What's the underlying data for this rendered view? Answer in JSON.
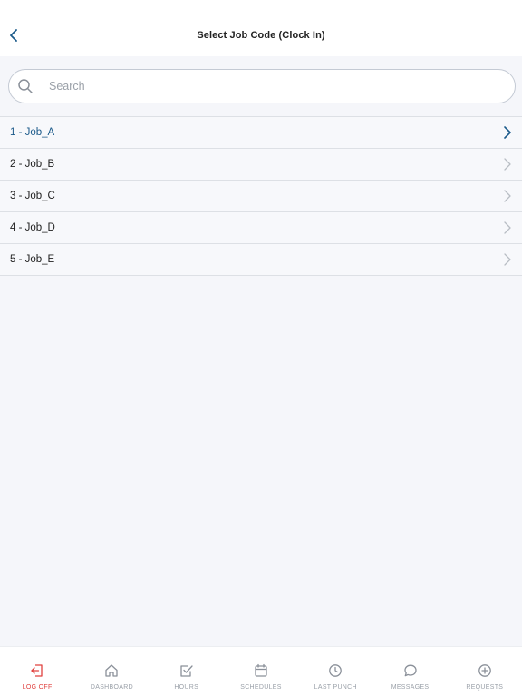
{
  "header": {
    "title": "Select Job Code (Clock In)"
  },
  "search": {
    "placeholder": "Search"
  },
  "jobs": [
    {
      "label": "1 - Job_A"
    },
    {
      "label": "2 - Job_B"
    },
    {
      "label": "3 - Job_C"
    },
    {
      "label": "4 - Job_D"
    },
    {
      "label": "5 - Job_E"
    }
  ],
  "tabs": [
    {
      "label": "LOG OFF",
      "icon": "log-off-icon"
    },
    {
      "label": "DASHBOARD",
      "icon": "home-icon"
    },
    {
      "label": "HOURS",
      "icon": "checkbox-icon"
    },
    {
      "label": "SCHEDULES",
      "icon": "calendar-icon"
    },
    {
      "label": "LAST PUNCH",
      "icon": "clock-icon"
    },
    {
      "label": "MESSAGES",
      "icon": "chat-bubble-icon"
    },
    {
      "label": "REQUESTS",
      "icon": "plus-circle-icon"
    }
  ],
  "colors": {
    "accent": "#1b5a8a",
    "logoff": "#e0413f",
    "muted": "#9aa0a8"
  }
}
